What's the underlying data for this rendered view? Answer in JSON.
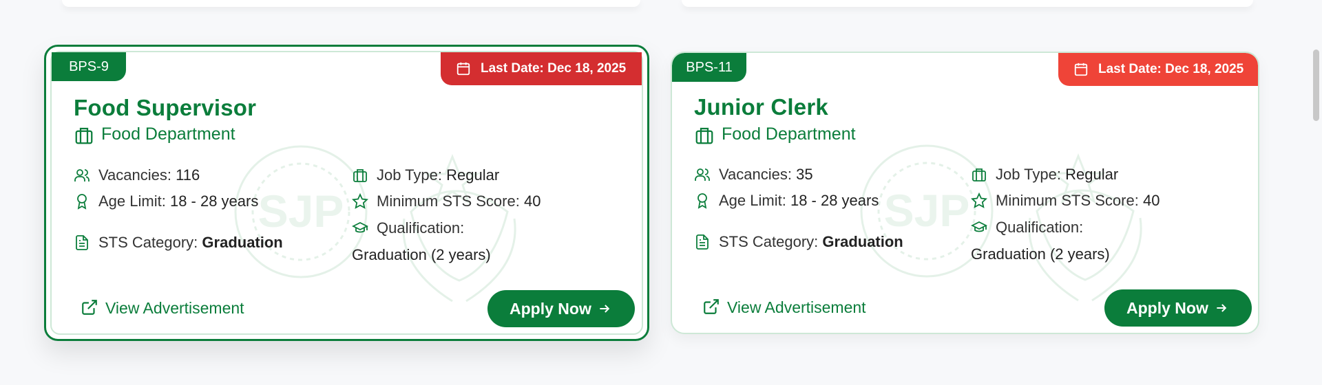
{
  "cards": [
    {
      "grade": "BPS-9",
      "last_date": "Last Date: Dec 18, 2025",
      "title": "Food Supervisor",
      "department": "Food Department",
      "vacancies_label": "Vacancies:",
      "vacancies": "116",
      "age_label": "Age Limit:",
      "age": "18 - 28 years",
      "sts_category_label": "STS Category:",
      "sts_category": "Graduation",
      "job_type_label": "Job Type:",
      "job_type": "Regular",
      "min_sts_label": "Minimum STS Score:",
      "min_sts": "40",
      "qualification_label": "Qualification:",
      "qualification": "Graduation (2 years)",
      "view_ad": "View Advertisement",
      "apply": "Apply Now"
    },
    {
      "grade": "BPS-11",
      "last_date": "Last Date: Dec 18, 2025",
      "title": "Junior Clerk",
      "department": "Food Department",
      "vacancies_label": "Vacancies:",
      "vacancies": "35",
      "age_label": "Age Limit:",
      "age": "18 - 28 years",
      "sts_category_label": "STS Category:",
      "sts_category": "Graduation",
      "job_type_label": "Job Type:",
      "job_type": "Regular",
      "min_sts_label": "Minimum STS Score:",
      "min_sts": "40",
      "qualification_label": "Qualification:",
      "qualification": "Graduation (2 years)",
      "view_ad": "View Advertisement",
      "apply": "Apply Now"
    }
  ],
  "watermark_text": "SJP",
  "colors": {
    "brand_green": "#0b7d3b",
    "deadline_red": "#d42e30",
    "deadline_red_light": "#ef4438",
    "card_border": "#cde8d6"
  },
  "icons": [
    "calendar-icon",
    "briefcase-icon",
    "users-icon",
    "award-icon",
    "file-text-icon",
    "star-icon",
    "graduation-cap-icon",
    "external-link-icon",
    "arrow-right-icon"
  ]
}
